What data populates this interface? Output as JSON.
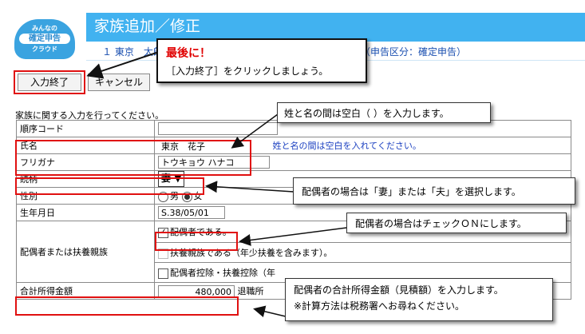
{
  "header": {
    "logo_top": "みんなの",
    "logo_mid": "確定申告",
    "logo_bottom": "クラウド",
    "title": "家族追加／修正",
    "info_left": "１ 東京　太郎",
    "info_right": "６年分　（申告区分：確定申告）"
  },
  "toolbar": {
    "finish_label": "入力終了",
    "cancel_label": "キャンセル"
  },
  "intro": "家族に関する入力を行ってください。",
  "form": {
    "order_code_label": "順序コード",
    "name_label": "氏名",
    "name_value": "東京　花子",
    "name_hint": "姓と名の間は空白を入れてください。",
    "kana_label": "フリガナ",
    "kana_value": "トウキョウ ハナコ",
    "relation_label": "続柄",
    "relation_value": "妻",
    "gender_label": "性別",
    "gender_male": "男",
    "gender_female": "女",
    "birth_label": "生年月日",
    "birth_value": "S.38/05/01",
    "spouse_group_label": "配偶者または扶養親族",
    "spouse_check": "配偶者である。",
    "dependent_check": "扶養親族である（年少扶養を含みます）。",
    "deduction_check": "配偶者控除・扶養控除（年",
    "income_label": "合計所得金額",
    "income_value": "480,000",
    "retire_text": "退職所"
  },
  "tooltips": {
    "last_title": "最後に！",
    "last_body": "［入力終了］をクリックしましょう。",
    "space": "姓と名の間は空白（ ）を入力します。",
    "relation": "配偶者の場合は「妻」または「夫」を選択します。",
    "spouse": "配偶者の場合はチェックＯＮにします。",
    "income_1": "配偶者の合計所得金額（見積額）を入力します。",
    "income_2": "※計算方法は税務署へお尋ねください。"
  },
  "colors": {
    "header_blue": "#41b2f0",
    "highlight_red": "#e01010",
    "hint_blue": "#1a3fc0"
  }
}
